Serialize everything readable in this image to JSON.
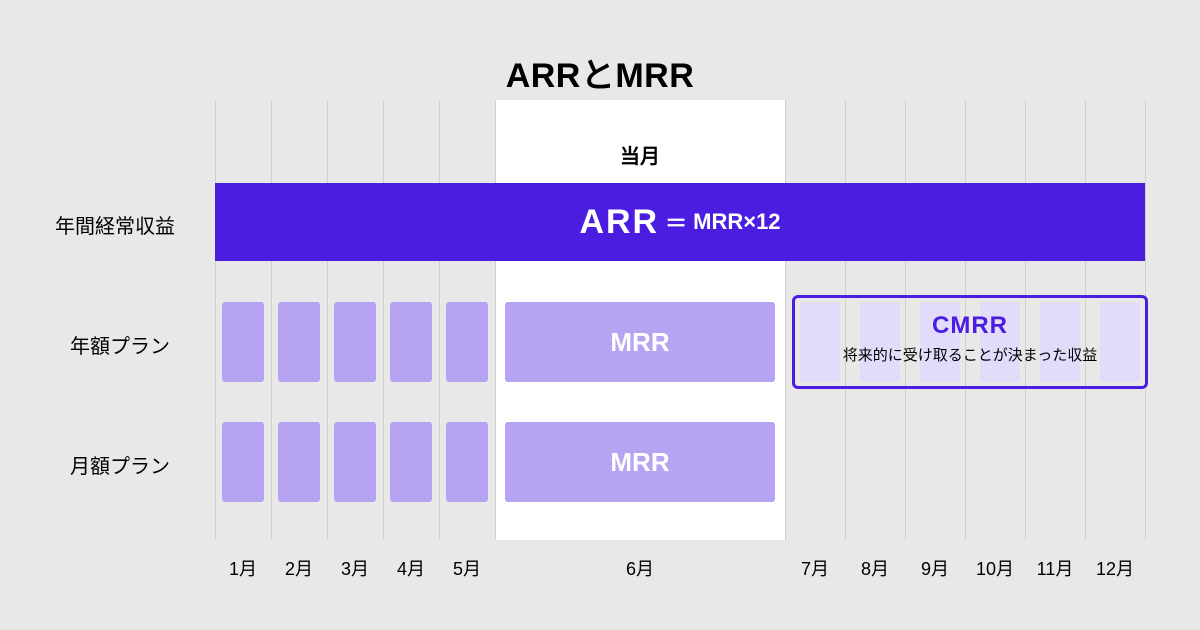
{
  "title": "ARRとMRR",
  "current_month_label": "当月",
  "rows": {
    "arr_label": "年間経常収益",
    "annual_plan_label": "年額プラン",
    "monthly_plan_label": "月額プラン"
  },
  "arr_bar": {
    "big": "ARR",
    "eq": "＝",
    "formula": "MRR×12"
  },
  "mrr_label_annual": "MRR",
  "mrr_label_monthly": "MRR",
  "cmrr": {
    "title": "CMRR",
    "subtitle": "将来的に受け取ることが決まった収益"
  },
  "months": [
    "1月",
    "2月",
    "3月",
    "4月",
    "5月",
    "6月",
    "7月",
    "8月",
    "9月",
    "10月",
    "11月",
    "12月"
  ]
}
